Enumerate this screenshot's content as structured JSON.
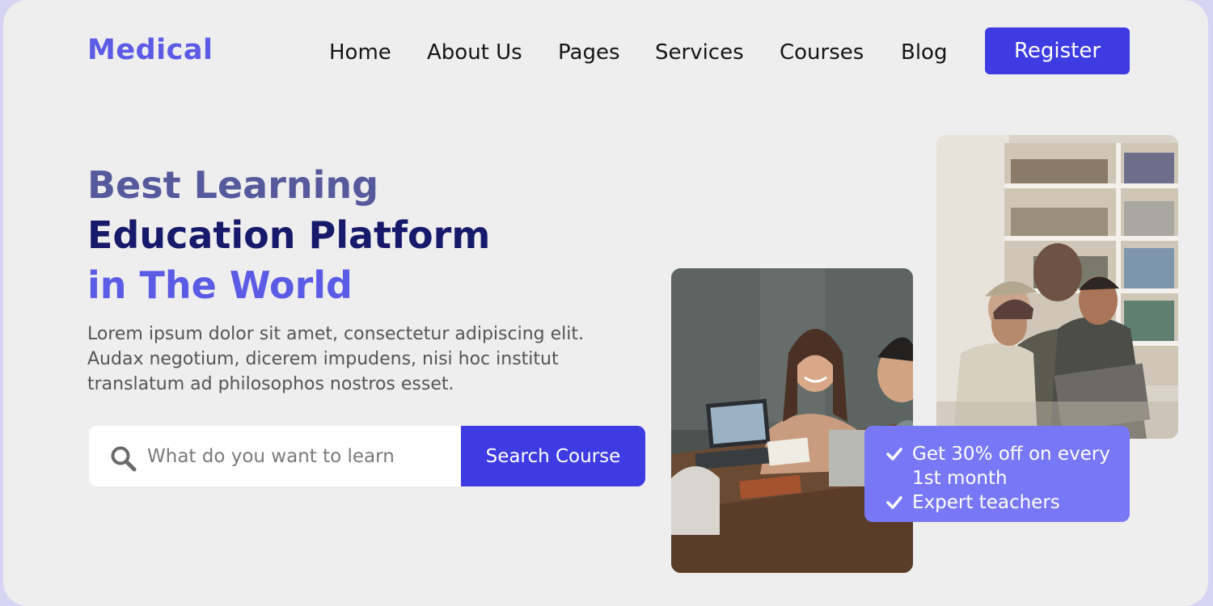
{
  "brand": {
    "logo": "Medical"
  },
  "nav": {
    "items": [
      "Home",
      "About Us",
      "Pages",
      "Services",
      "Courses",
      "Blog"
    ],
    "register_label": "Register"
  },
  "hero": {
    "title_line1": "Best Learning",
    "title_line2": "Education Platform",
    "title_line3": "in The World",
    "description": "Lorem ipsum dolor sit amet, consectetur adipiscing elit. Audax negotium, dicerem impudens, nisi hoc institut translatum ad philosophos nostros esset."
  },
  "search": {
    "placeholder": "What do you want to learn",
    "button_label": "Search Course"
  },
  "promo": {
    "items": [
      "Get 30% off on every 1st month",
      "Expert teachers"
    ]
  },
  "colors": {
    "accent": "#3e3be3",
    "brand": "#5b5be6",
    "promo_bg": "#7878f7",
    "title_dark": "#17196a",
    "title_muted": "#565a9c"
  },
  "icons": {
    "search": "search-icon",
    "check": "check-icon"
  }
}
